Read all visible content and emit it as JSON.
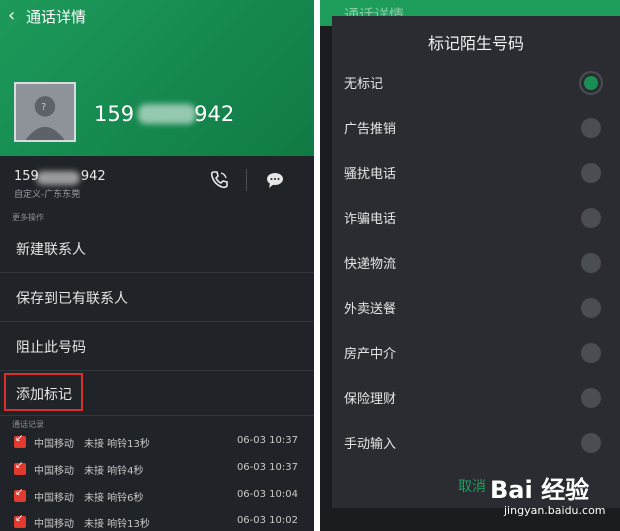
{
  "left": {
    "header_title": "通话详情",
    "number_display": "159942",
    "number_prefix": "159",
    "number_suffix": "942",
    "location": "自定义-广东东莞",
    "more_label": "更多操作",
    "menu": [
      "新建联系人",
      "保存到已有联系人",
      "阻止此号码",
      "添加标记"
    ],
    "call_log_label": "通话记录",
    "call_log": [
      {
        "carrier": "中国移动",
        "status": "未接 响铃13秒",
        "time": "06-03 10:37"
      },
      {
        "carrier": "中国移动",
        "status": "未接 响铃4秒",
        "time": "06-03 10:37"
      },
      {
        "carrier": "中国移动",
        "status": "未接 响铃6秒",
        "time": "06-03 10:04"
      },
      {
        "carrier": "中国移动",
        "status": "未接 响铃13秒",
        "time": "06-03 10:02"
      }
    ]
  },
  "right": {
    "bg_title": "通话详情",
    "dialog_title": "标记陌生号码",
    "options": [
      "无标记",
      "广告推销",
      "骚扰电话",
      "诈骗电话",
      "快递物流",
      "外卖送餐",
      "房产中介",
      "保险理财",
      "手动输入"
    ],
    "selected_index": 0,
    "cancel": "取消"
  },
  "watermark": {
    "text": "Bai 经验",
    "url": "jingyan.baidu.com"
  },
  "colors": {
    "accent_green": "#1a9a58",
    "highlight_red": "#d9302c"
  }
}
